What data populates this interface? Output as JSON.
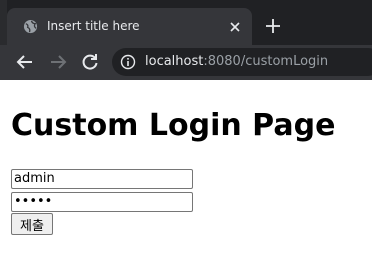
{
  "browser": {
    "tab": {
      "title": "Insert title here",
      "favicon_icon": "globe-icon",
      "close_icon": "close-icon"
    },
    "new_tab_icon": "plus-icon",
    "toolbar": {
      "back_icon": "arrow-left-icon",
      "forward_icon": "arrow-right-icon",
      "reload_icon": "reload-icon",
      "info_icon": "info-icon"
    },
    "url": {
      "host": "localhost",
      "rest": ":8080/customLogin"
    }
  },
  "page": {
    "heading": "Custom Login Page",
    "username_value": "admin",
    "password_value": "admin",
    "submit_label": "제출"
  },
  "colors": {
    "tabstrip_bg": "#202124",
    "active_tab_bg": "#35363a",
    "omnibox_bg": "#202124",
    "text_light": "#e8eaed",
    "text_muted": "#9aa0a6"
  }
}
